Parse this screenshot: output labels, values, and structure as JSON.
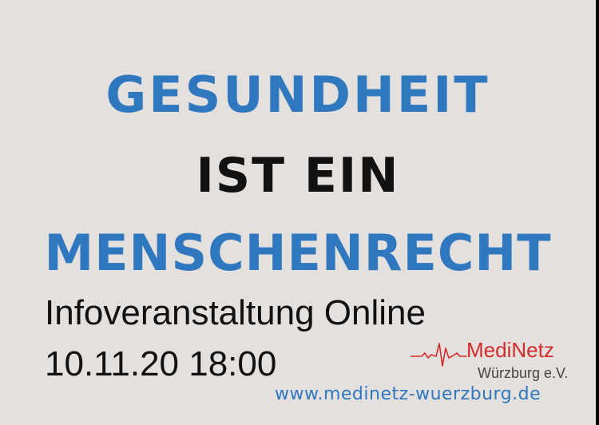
{
  "headline": {
    "line1": "GESUNDHEIT",
    "line2": "IST EIN",
    "line3": "MENSCHENRECHT"
  },
  "event": {
    "title": "Infoveranstaltung Online",
    "datetime": "10.11.20 18:00"
  },
  "logo": {
    "name": "MediNetz",
    "city": "Würzburg e.V.",
    "icon": "heartbeat-pulse-icon"
  },
  "website": "www.medinetz-wuerzburg.de",
  "colors": {
    "background": "#e3e0de",
    "border": "#000000",
    "accent_blue": "#2f78c0",
    "text_black": "#111111",
    "logo_red": "#d42b2b",
    "logo_gray": "#444444"
  }
}
